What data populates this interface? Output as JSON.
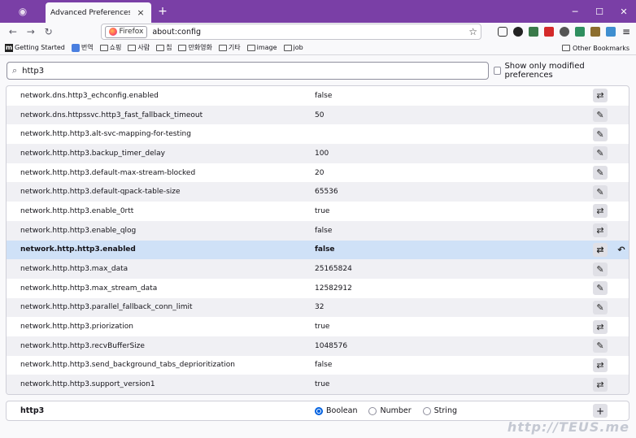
{
  "tab": {
    "title": "Advanced Preferences",
    "close": "×"
  },
  "newtab": "+",
  "window": {
    "minimize": "─",
    "maximize": "☐",
    "close": "✕"
  },
  "nav": {
    "back": "←",
    "forward": "→",
    "reload": "↻"
  },
  "urlbar": {
    "identity": "Firefox",
    "url": "about:config",
    "star": "☆"
  },
  "menu": "≡",
  "bookmarks": {
    "items": [
      "Getting Started",
      "번역",
      "쇼핑",
      "사람",
      "칩",
      "만화영화",
      "기타",
      "image",
      "job"
    ],
    "other": "Other Bookmarks"
  },
  "search": {
    "value": "http3",
    "modified_label": "Show only modified preferences"
  },
  "prefs": [
    {
      "name": "network.dns.http3_echconfig.enabled",
      "value": "false",
      "action": "toggle"
    },
    {
      "name": "network.dns.httpssvc.http3_fast_fallback_timeout",
      "value": "50",
      "action": "edit"
    },
    {
      "name": "network.http.http3.alt-svc-mapping-for-testing",
      "value": "",
      "action": "edit"
    },
    {
      "name": "network.http.http3.backup_timer_delay",
      "value": "100",
      "action": "edit"
    },
    {
      "name": "network.http.http3.default-max-stream-blocked",
      "value": "20",
      "action": "edit"
    },
    {
      "name": "network.http.http3.default-qpack-table-size",
      "value": "65536",
      "action": "edit"
    },
    {
      "name": "network.http.http3.enable_0rtt",
      "value": "true",
      "action": "toggle"
    },
    {
      "name": "network.http.http3.enable_qlog",
      "value": "false",
      "action": "toggle"
    },
    {
      "name": "network.http.http3.enabled",
      "value": "false",
      "action": "toggle",
      "modified": true
    },
    {
      "name": "network.http.http3.max_data",
      "value": "25165824",
      "action": "edit"
    },
    {
      "name": "network.http.http3.max_stream_data",
      "value": "12582912",
      "action": "edit"
    },
    {
      "name": "network.http.http3.parallel_fallback_conn_limit",
      "value": "32",
      "action": "edit"
    },
    {
      "name": "network.http.http3.priorization",
      "value": "true",
      "action": "toggle"
    },
    {
      "name": "network.http.http3.recvBufferSize",
      "value": "1048576",
      "action": "edit"
    },
    {
      "name": "network.http.http3.send_background_tabs_deprioritization",
      "value": "false",
      "action": "toggle"
    },
    {
      "name": "network.http.http3.support_version1",
      "value": "true",
      "action": "toggle"
    }
  ],
  "icons": {
    "toggle": "⇄",
    "edit": "✎",
    "reset": "↶"
  },
  "add": {
    "name": "http3",
    "types": [
      "Boolean",
      "Number",
      "String"
    ],
    "selected": "Boolean",
    "button": "+"
  },
  "watermark": "http://TEUS.me"
}
